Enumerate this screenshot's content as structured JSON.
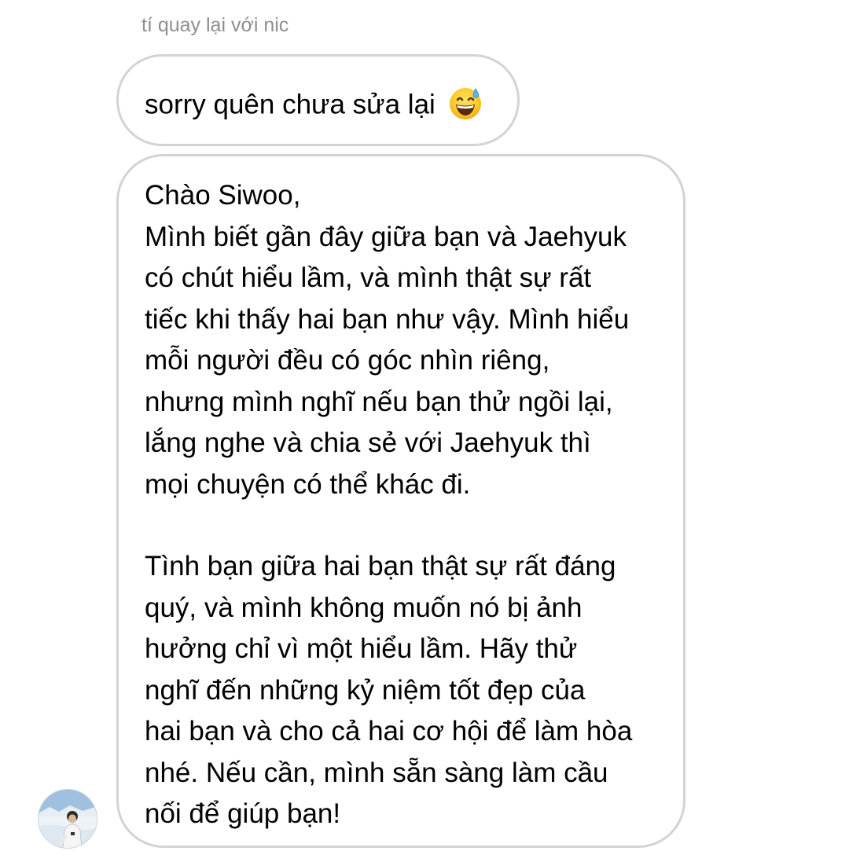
{
  "thread": {
    "sender_label": "tí quay lại với nic"
  },
  "messages": [
    {
      "text": "sorry quên chưa sửa lại",
      "emoji": "grinning-face-with-sweat-icon"
    },
    {
      "paragraphs": [
        "Chào Siwoo,\nMình biết gần đây giữa bạn và Jaehyuk\ncó chút hiểu lầm, và mình thật sự rất\ntiếc khi thấy hai bạn như vậy. Mình hiểu\nmỗi người đều có góc nhìn riêng,\nnhưng mình nghĩ nếu bạn thử ngồi lại,\nlắng nghe và chia sẻ với Jaehyuk thì\nmọi chuyện có thể khác đi.",
        "Tình bạn giữa hai bạn thật sự rất đáng\nquý, và mình không muốn nó bị ảnh\nhưởng chỉ vì một hiểu lầm. Hãy thử\nnghĩ đến những kỷ niệm tốt đẹp của\nhai bạn và cho cả hai cơ hội để làm hòa\nnhé. Nếu cần, mình sẵn sàng làm cầu\nnối để giúp bạn!"
      ]
    }
  ],
  "colors": {
    "bubble_border": "#d3d3d3",
    "label_text": "#8e8e8e",
    "message_text": "#000000",
    "background": "#ffffff"
  }
}
